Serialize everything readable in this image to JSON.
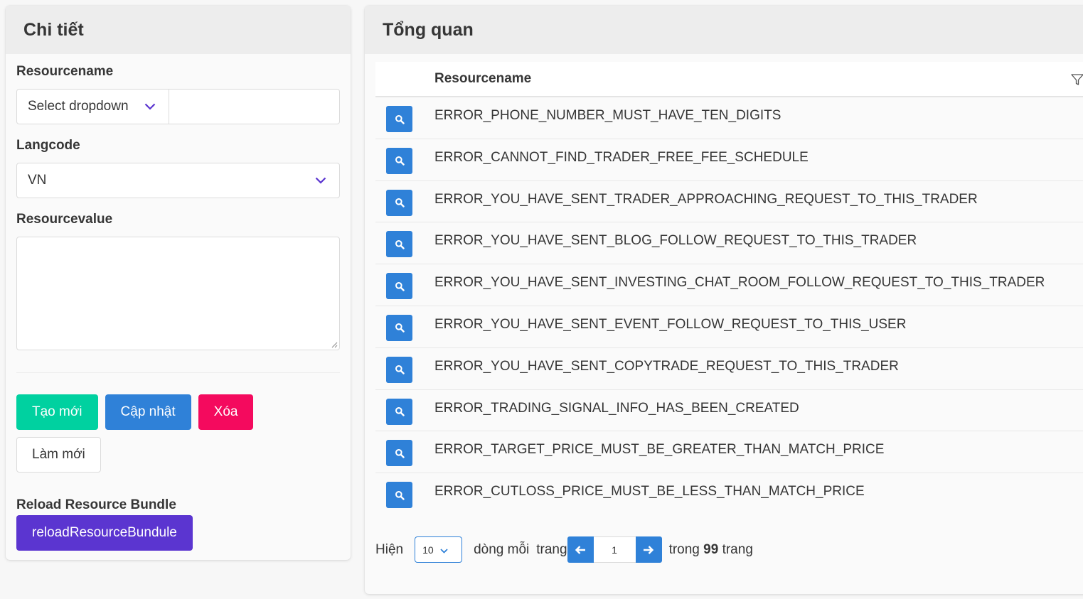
{
  "detail_panel": {
    "title": "Chi tiết",
    "resourcename_label": "Resourcename",
    "resourcename_select": "Select dropdown",
    "resourcename_value": "",
    "langcode_label": "Langcode",
    "langcode_value": "VN",
    "resourcevalue_label": "Resourcevalue",
    "resourcevalue_value": "",
    "buttons": {
      "create": "Tạo mới",
      "update": "Cập nhật",
      "delete": "Xóa",
      "refresh": "Làm mới"
    },
    "reload_label": "Reload Resource Bundle",
    "reload_button": "reloadResourceBundule"
  },
  "overview_panel": {
    "title": "Tổng quan",
    "column_header": "Resourcename",
    "rows": [
      "ERROR_PHONE_NUMBER_MUST_HAVE_TEN_DIGITS",
      "ERROR_CANNOT_FIND_TRADER_FREE_FEE_SCHEDULE",
      "ERROR_YOU_HAVE_SENT_TRADER_APPROACHING_REQUEST_TO_THIS_TRADER",
      "ERROR_YOU_HAVE_SENT_BLOG_FOLLOW_REQUEST_TO_THIS_TRADER",
      "ERROR_YOU_HAVE_SENT_INVESTING_CHAT_ROOM_FOLLOW_REQUEST_TO_THIS_TRADER",
      "ERROR_YOU_HAVE_SENT_EVENT_FOLLOW_REQUEST_TO_THIS_USER",
      "ERROR_YOU_HAVE_SENT_COPYTRADE_REQUEST_TO_THIS_TRADER",
      "ERROR_TRADING_SIGNAL_INFO_HAS_BEEN_CREATED",
      "ERROR_TARGET_PRICE_MUST_BE_GREATER_THAN_MATCH_PRICE",
      "ERROR_CUTLOSS_PRICE_MUST_BE_LESS_THAN_MATCH_PRICE"
    ],
    "pagination": {
      "show_label": "Hiện",
      "per_page": "10",
      "rows_per_label": "dòng mỗi",
      "page_label": "trang",
      "current_page": "1",
      "of_label": "trong",
      "total_pages": "99",
      "pages_label": "trang"
    }
  },
  "colors": {
    "primary": "#2f81d8",
    "success": "#00d1a0",
    "danger": "#f40a5e",
    "purple": "#5b35d0",
    "chevron": "#5b35d0"
  },
  "icons": {
    "row_action": "search-icon",
    "filter": "filter-icon",
    "prev": "arrow-left-icon",
    "next": "arrow-right-icon",
    "dropdown": "chevron-down-icon"
  }
}
